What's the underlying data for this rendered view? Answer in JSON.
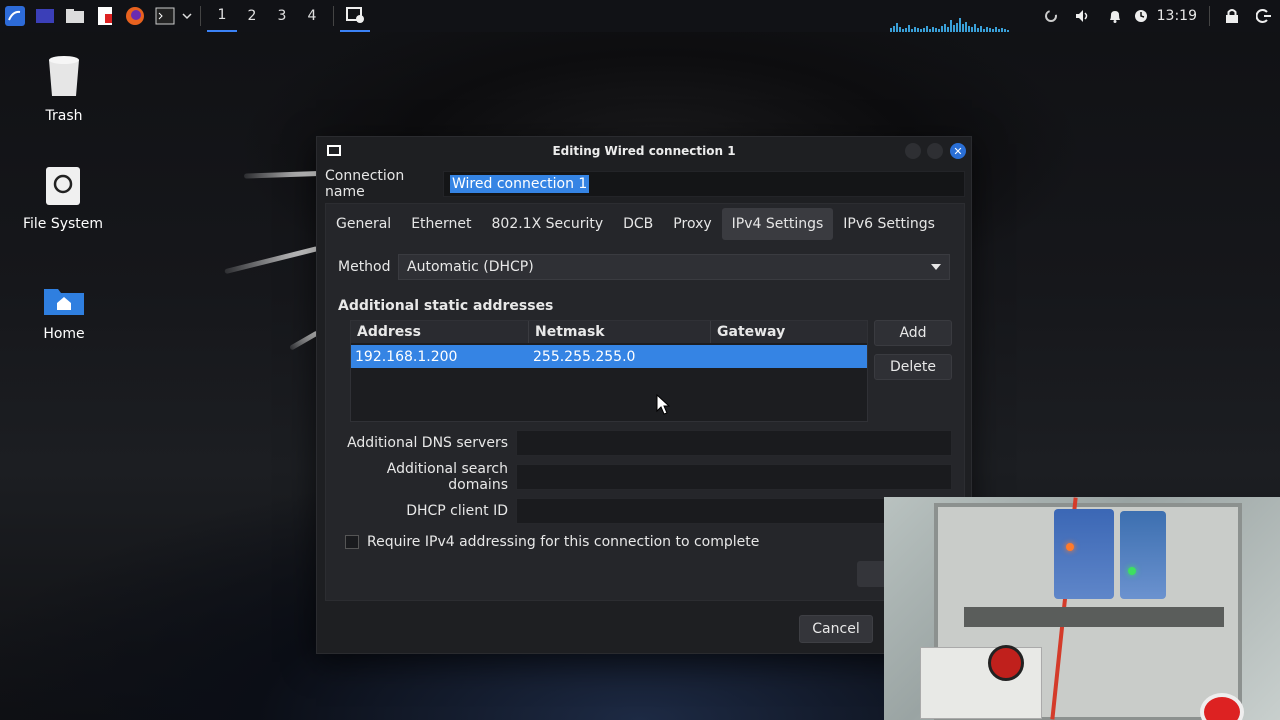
{
  "taskbar": {
    "workspaces": [
      "1",
      "2",
      "3",
      "4"
    ],
    "active_workspace": "1",
    "clock": "13:19",
    "accent_color": "#3b82f6"
  },
  "desktop": {
    "icons": [
      {
        "label": "Trash",
        "icon": "trash-icon"
      },
      {
        "label": "File System",
        "icon": "drive-icon"
      },
      {
        "label": "Home",
        "icon": "home-folder-icon"
      }
    ]
  },
  "window": {
    "title": "Editing Wired connection 1",
    "connection_name_label": "Connection name",
    "connection_name_value": "Wired connection 1",
    "tabs": [
      "General",
      "Ethernet",
      "802.1X Security",
      "DCB",
      "Proxy",
      "IPv4 Settings",
      "IPv6 Settings"
    ],
    "active_tab": "IPv4 Settings",
    "method_label": "Method",
    "method_value": "Automatic (DHCP)",
    "static_title": "Additional static addresses",
    "table": {
      "columns": [
        "Address",
        "Netmask",
        "Gateway"
      ],
      "rows": [
        {
          "address": "192.168.1.200",
          "netmask": "255.255.255.0",
          "gateway": ""
        }
      ]
    },
    "add_label": "Add",
    "delete_label": "Delete",
    "dns_label": "Additional DNS servers",
    "search_domains_label": "Additional search domains",
    "dhcp_client_label": "DHCP client ID",
    "require_label": "Require IPv4 addressing for this connection to complete",
    "cancel_label": "Cancel",
    "selection_color": "#3584e4"
  }
}
